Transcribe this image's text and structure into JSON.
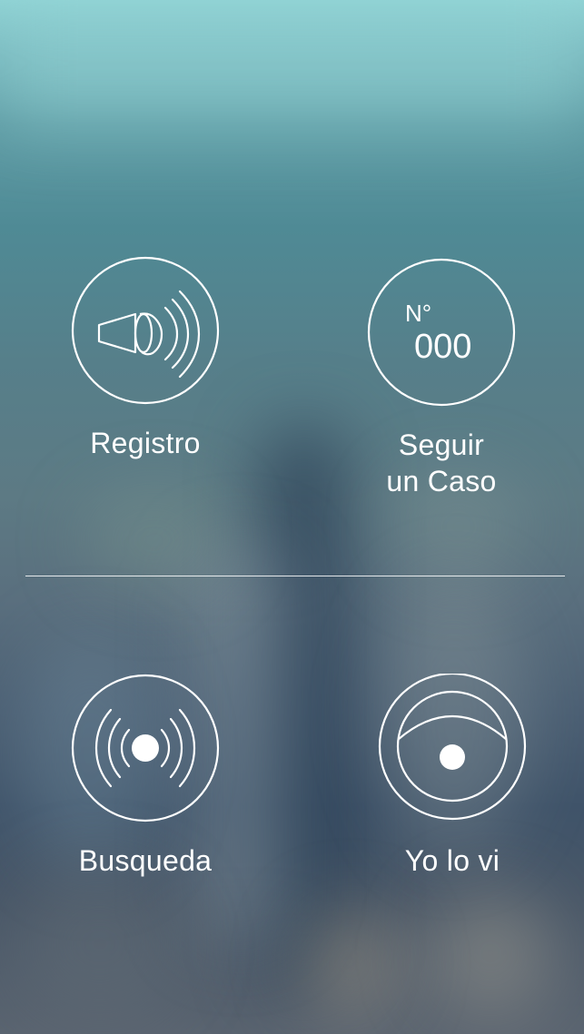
{
  "menu": {
    "registro": {
      "label": "Registro",
      "icon": "megaphone-icon"
    },
    "seguir": {
      "label_line1": "Seguir",
      "label_line2": "un Caso",
      "icon": "case-number-icon",
      "number_prefix": "N°",
      "number": "000"
    },
    "busqueda": {
      "label": "Busqueda",
      "icon": "signal-broadcast-icon"
    },
    "yolovi": {
      "label": "Yo lo vi",
      "icon": "eye-icon"
    }
  },
  "colors": {
    "foreground": "#ffffff",
    "sky": "#8fd2d4",
    "city": "#3f5369"
  }
}
